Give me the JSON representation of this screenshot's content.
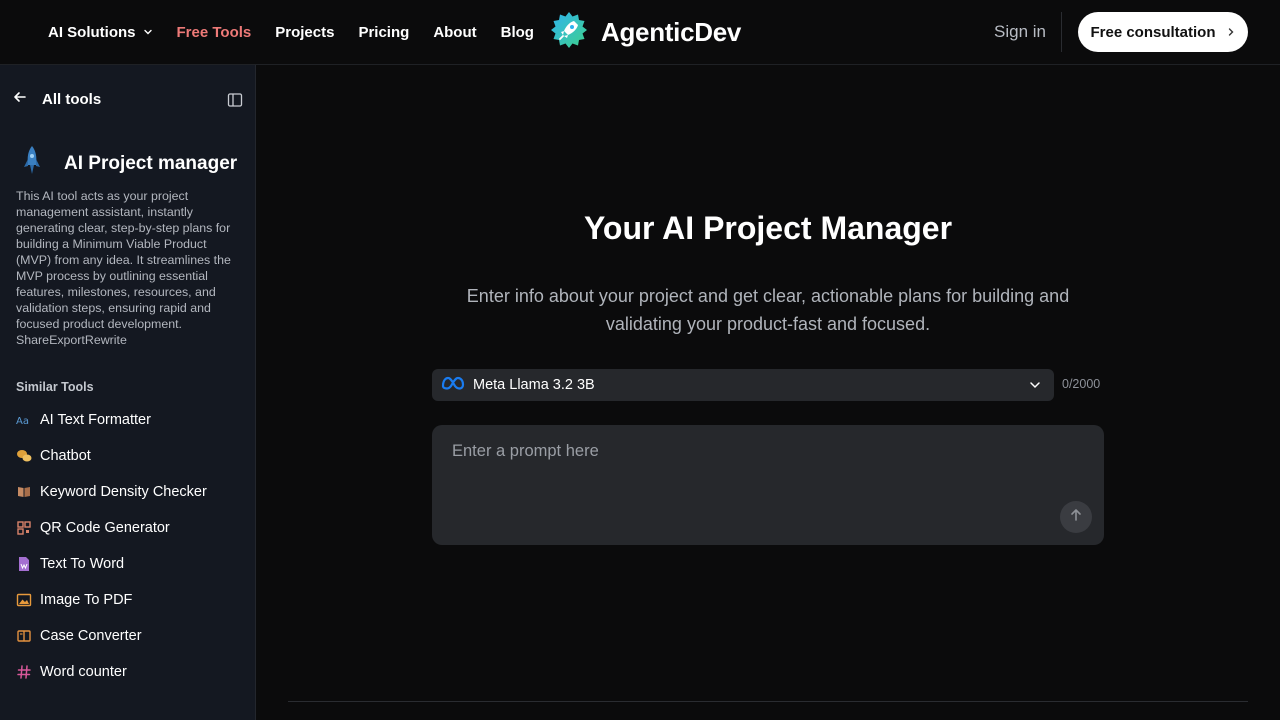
{
  "header": {
    "nav": [
      {
        "label": "AI Solutions"
      },
      {
        "label": "Free Tools"
      },
      {
        "label": "Projects"
      },
      {
        "label": "Pricing"
      },
      {
        "label": "About"
      },
      {
        "label": "Blog"
      }
    ],
    "logo_text": "AgenticDev",
    "sign_in": "Sign in",
    "cta": "Free consultation"
  },
  "sidebar": {
    "back_label": "All tools",
    "tool_title": "AI Project manager",
    "tool_description": "This AI tool acts as your project management assistant, instantly generating clear, step-by-step plans for building a Minimum Viable Product (MVP) from any idea. It streamlines the MVP process by outlining essential features, milestones, resources, and validation steps, ensuring rapid and focused product development.",
    "tool_actions": "ShareExportRewrite",
    "similar_heading": "Similar Tools",
    "similar_tools": [
      {
        "label": "AI Text Formatter",
        "icon": "text-format-icon"
      },
      {
        "label": "Chatbot",
        "icon": "chat-bubbles-icon"
      },
      {
        "label": "Keyword Density Checker",
        "icon": "book-icon"
      },
      {
        "label": "QR Code Generator",
        "icon": "qr-code-icon"
      },
      {
        "label": "Text To Word",
        "icon": "word-doc-icon"
      },
      {
        "label": "Image To PDF",
        "icon": "image-icon"
      },
      {
        "label": "Case Converter",
        "icon": "case-convert-icon"
      },
      {
        "label": "Word counter",
        "icon": "hash-icon"
      }
    ]
  },
  "main": {
    "title": "Your AI Project Manager",
    "subtitle": "Enter info about your project and get clear, actionable plans for building and validating your product-fast and focused.",
    "model": "Meta Llama 3.2 3B",
    "char_count": "0/2000",
    "prompt_placeholder": "Enter a prompt here"
  },
  "colors": {
    "background": "#0b0b0c",
    "sidebar_bg": "#141821",
    "accent_free_tools": "#ee7a78",
    "input_bg": "#26282c"
  }
}
